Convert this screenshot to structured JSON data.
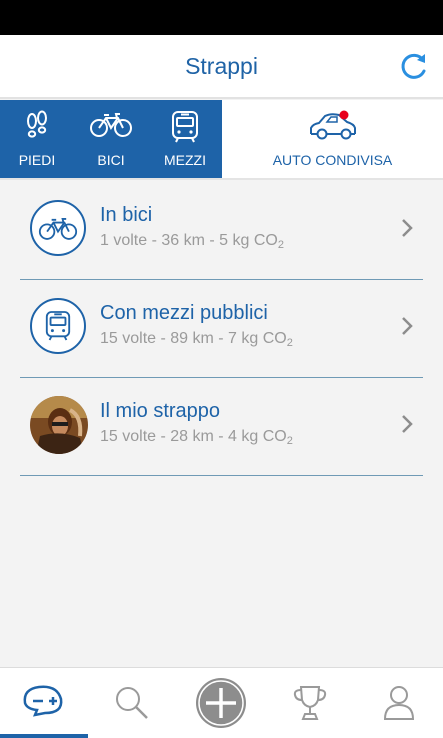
{
  "header": {
    "title": "Strappi",
    "refresh_icon": "refresh-icon"
  },
  "tabs": [
    {
      "label": "PIEDI",
      "icon": "footsteps-icon"
    },
    {
      "label": "BICI",
      "icon": "bicycle-icon"
    },
    {
      "label": "MEZZI",
      "icon": "bus-icon"
    },
    {
      "label": "AUTO CONDIVISA",
      "icon": "car-icon"
    }
  ],
  "rows": [
    {
      "title": "In bici",
      "stats": "1 volte - 36 km - 5 kg CO",
      "sub": "2",
      "icon": "bicycle-icon"
    },
    {
      "title": "Con mezzi pubblici",
      "stats": "15 volte - 89 km - 7 kg CO",
      "sub": "2",
      "icon": "bus-icon"
    },
    {
      "title": "Il mio strappo",
      "stats": "15 volte - 28 km - 4 kg CO",
      "sub": "2",
      "icon": "user-photo"
    }
  ],
  "bottom_nav": [
    {
      "icon": "rides-icon"
    },
    {
      "icon": "search-icon"
    },
    {
      "icon": "add-icon"
    },
    {
      "icon": "trophy-icon"
    },
    {
      "icon": "profile-icon"
    }
  ],
  "colors": {
    "primary": "#1e63a8",
    "muted": "#9a9a9a",
    "notify": "#e8001c"
  }
}
